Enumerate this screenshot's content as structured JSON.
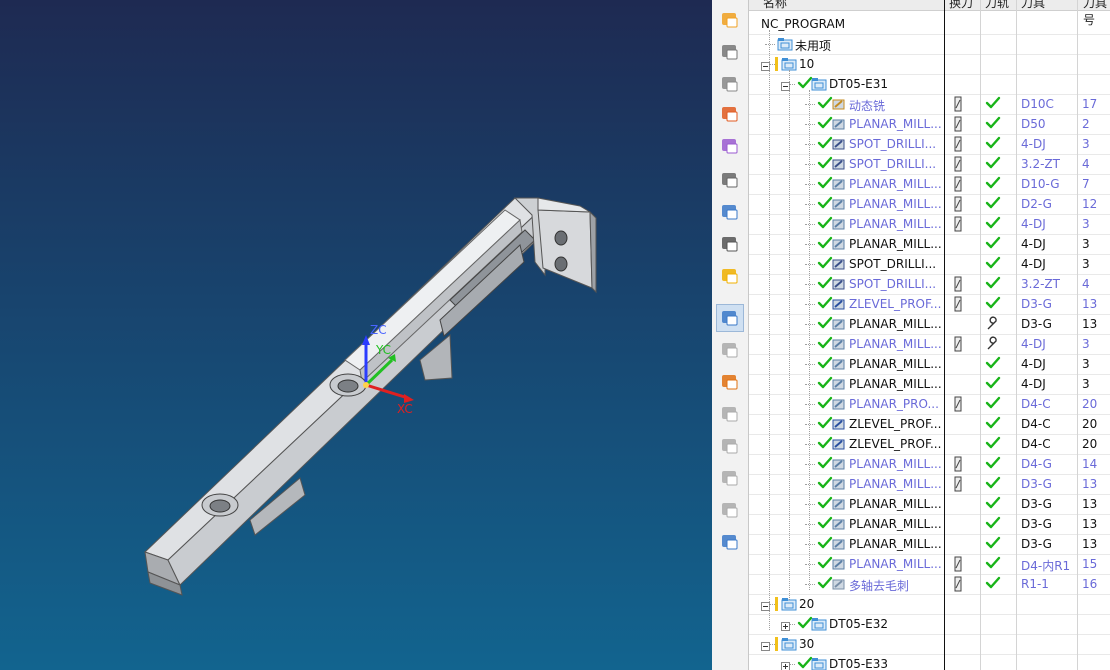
{
  "viewport": {
    "axis_labels": {
      "zc": "ZC",
      "yc": "YC",
      "xc": "XC"
    }
  },
  "toolbar": {
    "buttons": [
      "create-program-icon",
      "create-tool-icon",
      "create-geometry-icon",
      "create-method-icon",
      "create-operation-icon",
      "geometry-view-icon",
      "program-view-icon",
      "machine-tool-view-icon",
      "method-view-icon",
      "program-order-view-icon",
      "generate-toolpath-icon",
      "replay-toolpath-icon",
      "verify-toolpath-icon",
      "postprocess-icon",
      "shop-doc-icon",
      "simulate-machine-icon",
      "output-cls-icon"
    ]
  },
  "nav": {
    "columns": {
      "name": "名称",
      "tool_change": "换刀",
      "path": "刀轨",
      "tool": "刀具",
      "tool_num": "刀具号"
    },
    "rows": [
      {
        "name": "NC_PROGRAM",
        "level": 0,
        "kind": "root",
        "color": "black",
        "tc": "",
        "path": "",
        "tool": "",
        "num": ""
      },
      {
        "name": "未用项",
        "level": 1,
        "kind": "folder",
        "color": "black",
        "tc": "",
        "path": "",
        "tool": "",
        "num": ""
      },
      {
        "name": "10",
        "level": 1,
        "kind": "group",
        "color": "black",
        "tc": "",
        "path": "",
        "tool": "",
        "num": "",
        "expand": "minus"
      },
      {
        "name": "DT05-E31",
        "level": 2,
        "kind": "group-ok",
        "color": "black",
        "tc": "",
        "path": "",
        "tool": "",
        "num": "",
        "expand": "minus"
      },
      {
        "name": "动态铣",
        "level": 3,
        "kind": "op",
        "icon": "dynamic",
        "color": "blue",
        "tc": "tool",
        "path": "check",
        "tool": "D10C",
        "num": "17"
      },
      {
        "name": "PLANAR_MILL...",
        "level": 3,
        "kind": "op",
        "icon": "planar",
        "color": "blue",
        "tc": "tool",
        "path": "check",
        "tool": "D50",
        "num": "2"
      },
      {
        "name": "SPOT_DRILLI...",
        "level": 3,
        "kind": "op",
        "icon": "drill",
        "color": "blue",
        "tc": "tool",
        "path": "check",
        "tool": "4-DJ",
        "num": "3"
      },
      {
        "name": "SPOT_DRILLI...",
        "level": 3,
        "kind": "op",
        "icon": "drill",
        "color": "blue",
        "tc": "tool",
        "path": "check",
        "tool": "3.2-ZT",
        "num": "4"
      },
      {
        "name": "PLANAR_MILL...",
        "level": 3,
        "kind": "op",
        "icon": "planar",
        "color": "blue",
        "tc": "tool",
        "path": "check",
        "tool": "D10-G",
        "num": "7"
      },
      {
        "name": "PLANAR_MILL...",
        "level": 3,
        "kind": "op",
        "icon": "planar",
        "color": "blue",
        "tc": "tool",
        "path": "check",
        "tool": "D2-G",
        "num": "12"
      },
      {
        "name": "PLANAR_MILL...",
        "level": 3,
        "kind": "op",
        "icon": "planar",
        "color": "blue",
        "tc": "tool",
        "path": "check",
        "tool": "4-DJ",
        "num": "3"
      },
      {
        "name": "PLANAR_MILL...",
        "level": 3,
        "kind": "op",
        "icon": "planar",
        "color": "black",
        "tc": "",
        "path": "check",
        "tool": "4-DJ",
        "num": "3"
      },
      {
        "name": "SPOT_DRILLI...",
        "level": 3,
        "kind": "op",
        "icon": "drill",
        "color": "black",
        "tc": "",
        "path": "check",
        "tool": "4-DJ",
        "num": "3"
      },
      {
        "name": "SPOT_DRILLI...",
        "level": 3,
        "kind": "op",
        "icon": "drill",
        "color": "blue",
        "tc": "tool",
        "path": "check",
        "tool": "3.2-ZT",
        "num": "4"
      },
      {
        "name": "ZLEVEL_PROF...",
        "level": 3,
        "kind": "op",
        "icon": "zlevel",
        "color": "blue",
        "tc": "tool",
        "path": "check",
        "tool": "D3-G",
        "num": "13"
      },
      {
        "name": "PLANAR_MILL...",
        "level": 3,
        "kind": "op",
        "icon": "planar",
        "color": "black",
        "tc": "",
        "path": "wrench",
        "tool": "D3-G",
        "num": "13"
      },
      {
        "name": "PLANAR_MILL...",
        "level": 3,
        "kind": "op",
        "icon": "planar",
        "color": "blue",
        "tc": "tool",
        "path": "wrench",
        "tool": "4-DJ",
        "num": "3"
      },
      {
        "name": "PLANAR_MILL...",
        "level": 3,
        "kind": "op",
        "icon": "planar",
        "color": "black",
        "tc": "",
        "path": "check",
        "tool": "4-DJ",
        "num": "3"
      },
      {
        "name": "PLANAR_MILL...",
        "level": 3,
        "kind": "op",
        "icon": "planar",
        "color": "black",
        "tc": "",
        "path": "check",
        "tool": "4-DJ",
        "num": "3"
      },
      {
        "name": "PLANAR_PRO...",
        "level": 3,
        "kind": "op",
        "icon": "planar",
        "color": "blue",
        "tc": "tool",
        "path": "check",
        "tool": "D4-C",
        "num": "20"
      },
      {
        "name": "ZLEVEL_PROF...",
        "level": 3,
        "kind": "op",
        "icon": "zlevel",
        "color": "black",
        "tc": "",
        "path": "check",
        "tool": "D4-C",
        "num": "20"
      },
      {
        "name": "ZLEVEL_PROF...",
        "level": 3,
        "kind": "op",
        "icon": "zlevel",
        "color": "black",
        "tc": "",
        "path": "check",
        "tool": "D4-C",
        "num": "20"
      },
      {
        "name": "PLANAR_MILL...",
        "level": 3,
        "kind": "op",
        "icon": "planar",
        "color": "blue",
        "tc": "tool",
        "path": "check",
        "tool": "D4-G",
        "num": "14"
      },
      {
        "name": "PLANAR_MILL...",
        "level": 3,
        "kind": "op",
        "icon": "planar",
        "color": "blue",
        "tc": "tool",
        "path": "check",
        "tool": "D3-G",
        "num": "13"
      },
      {
        "name": "PLANAR_MILL...",
        "level": 3,
        "kind": "op",
        "icon": "planar",
        "color": "black",
        "tc": "",
        "path": "check",
        "tool": "D3-G",
        "num": "13"
      },
      {
        "name": "PLANAR_MILL...",
        "level": 3,
        "kind": "op",
        "icon": "planar",
        "color": "black",
        "tc": "",
        "path": "check",
        "tool": "D3-G",
        "num": "13"
      },
      {
        "name": "PLANAR_MILL...",
        "level": 3,
        "kind": "op",
        "icon": "planar",
        "color": "black",
        "tc": "",
        "path": "check",
        "tool": "D3-G",
        "num": "13"
      },
      {
        "name": "PLANAR_MILL...",
        "level": 3,
        "kind": "op",
        "icon": "planar",
        "color": "blue",
        "tc": "tool",
        "path": "check",
        "tool": "D4-内R1",
        "num": "15"
      },
      {
        "name": "多轴去毛刺",
        "level": 3,
        "kind": "op",
        "icon": "deburr",
        "color": "blue",
        "tc": "tool",
        "path": "check",
        "tool": "R1-1",
        "num": "16"
      },
      {
        "name": "20",
        "level": 1,
        "kind": "group",
        "color": "black",
        "tc": "",
        "path": "",
        "tool": "",
        "num": "",
        "expand": "minus"
      },
      {
        "name": "DT05-E32",
        "level": 2,
        "kind": "group-ok",
        "color": "black",
        "tc": "",
        "path": "",
        "tool": "",
        "num": "",
        "expand": "plus"
      },
      {
        "name": "30",
        "level": 1,
        "kind": "group",
        "color": "black",
        "tc": "",
        "path": "",
        "tool": "",
        "num": "",
        "expand": "minus"
      },
      {
        "name": "DT05-E33",
        "level": 2,
        "kind": "group-ok",
        "color": "black",
        "tc": "",
        "path": "",
        "tool": "",
        "num": "",
        "expand": "plus"
      }
    ]
  },
  "colors": {
    "check": "#19b419",
    "blue_text": "#6a6ad8",
    "folder": "#3f8fd6"
  }
}
